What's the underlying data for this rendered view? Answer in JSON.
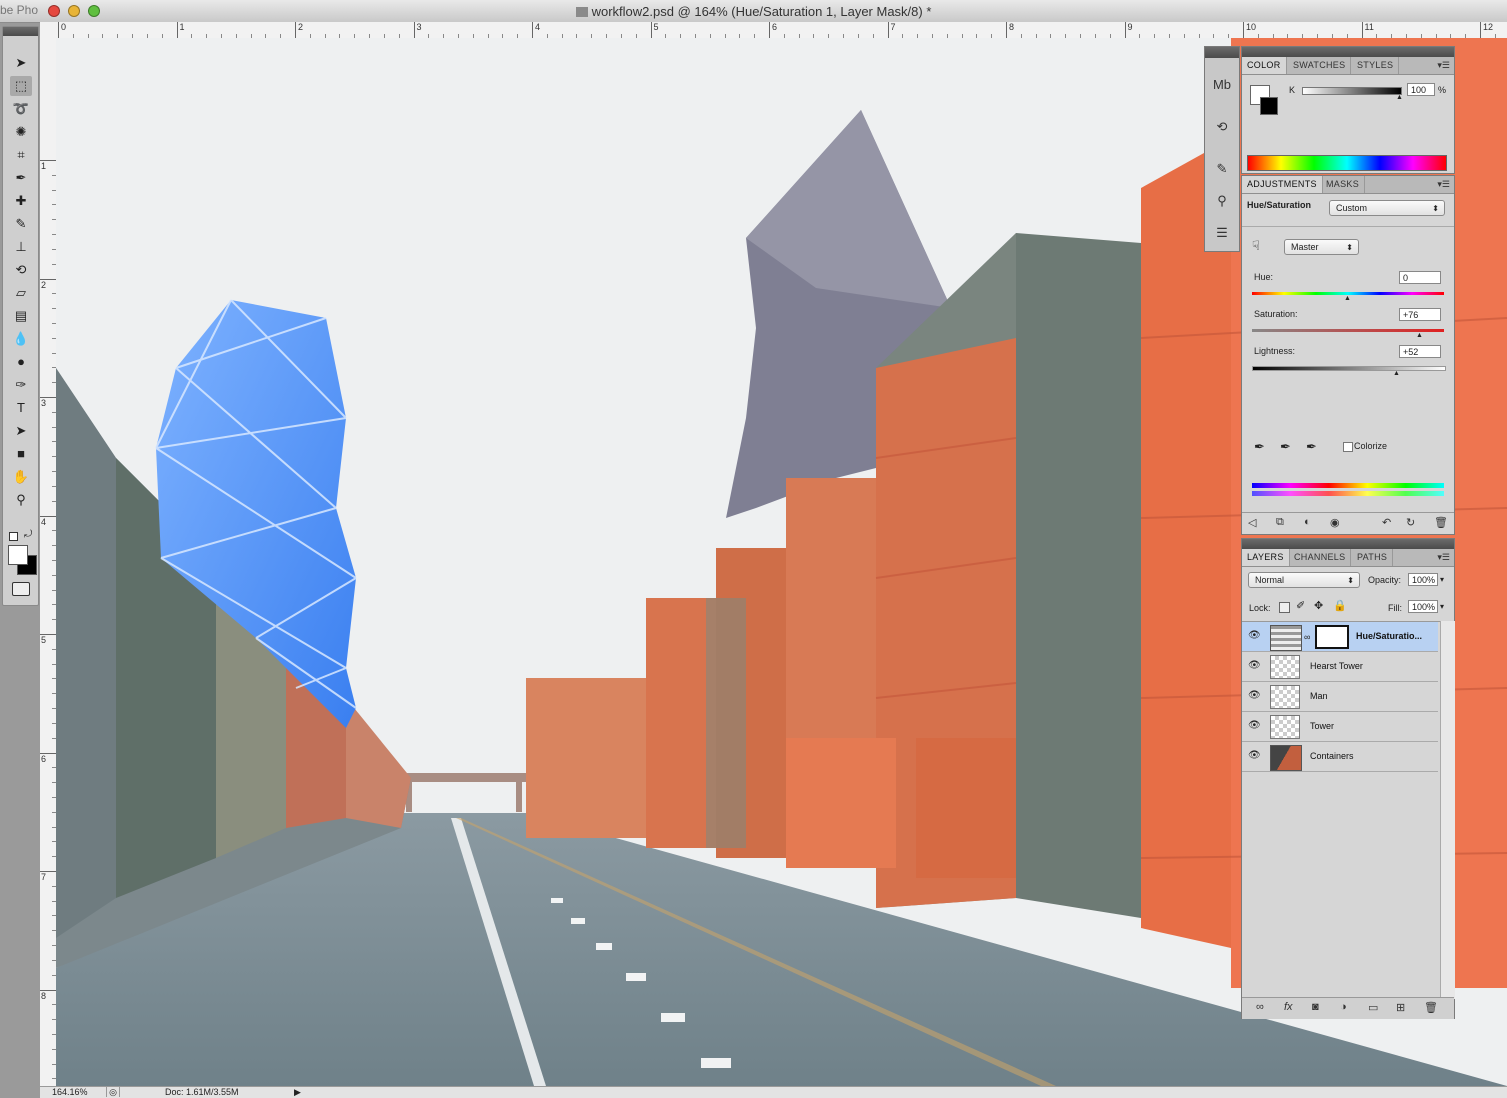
{
  "window": {
    "app_name": "be Pho",
    "title": "workflow2.psd @ 164% (Hue/Saturation 1, Layer Mask/8) *"
  },
  "ruler": {
    "h_labels": [
      "0",
      "1",
      "2",
      "3",
      "4",
      "5",
      "6",
      "7",
      "8",
      "9",
      "10",
      "11",
      "12"
    ],
    "v_labels": [
      "1",
      "2",
      "3",
      "4",
      "5",
      "6",
      "7",
      "8"
    ]
  },
  "tools": {
    "icons": [
      "move-icon",
      "marquee-icon",
      "lasso-icon",
      "quick-select-icon",
      "crop-icon",
      "eyedropper-icon",
      "healing-brush-icon",
      "brush-icon",
      "stamp-icon",
      "history-brush-icon",
      "eraser-icon",
      "gradient-icon",
      "blur-icon",
      "dodge-icon",
      "pen-icon",
      "type-icon",
      "path-select-icon",
      "shape-icon",
      "hand-icon",
      "zoom-icon"
    ]
  },
  "color_panel": {
    "tabs": [
      "COLOR",
      "SWATCHES",
      "STYLES"
    ],
    "channel_label": "K",
    "k_value": "100",
    "percent": "%"
  },
  "adjustments_panel": {
    "tabs": [
      "ADJUSTMENTS",
      "MASKS"
    ],
    "title": "Hue/Saturation",
    "preset": "Custom",
    "channel": "Master",
    "hue_label": "Hue:",
    "hue_value": "0",
    "saturation_label": "Saturation:",
    "saturation_value": "+76",
    "lightness_label": "Lightness:",
    "lightness_value": "+52",
    "colorize_label": "Colorize"
  },
  "layers_panel": {
    "tabs": [
      "LAYERS",
      "CHANNELS",
      "PATHS"
    ],
    "blend_mode": "Normal",
    "opacity_label": "Opacity:",
    "opacity_value": "100%",
    "lock_label": "Lock:",
    "fill_label": "Fill:",
    "fill_value": "100%",
    "layers": [
      {
        "name": "Hue/Saturatio...",
        "selected": true
      },
      {
        "name": "Hearst Tower",
        "selected": false
      },
      {
        "name": "Man",
        "selected": false
      },
      {
        "name": "Tower",
        "selected": false
      },
      {
        "name": "Containers",
        "selected": false
      }
    ]
  },
  "status": {
    "zoom": "164.16%",
    "doc": "Doc: 1.61M/3.55M"
  }
}
